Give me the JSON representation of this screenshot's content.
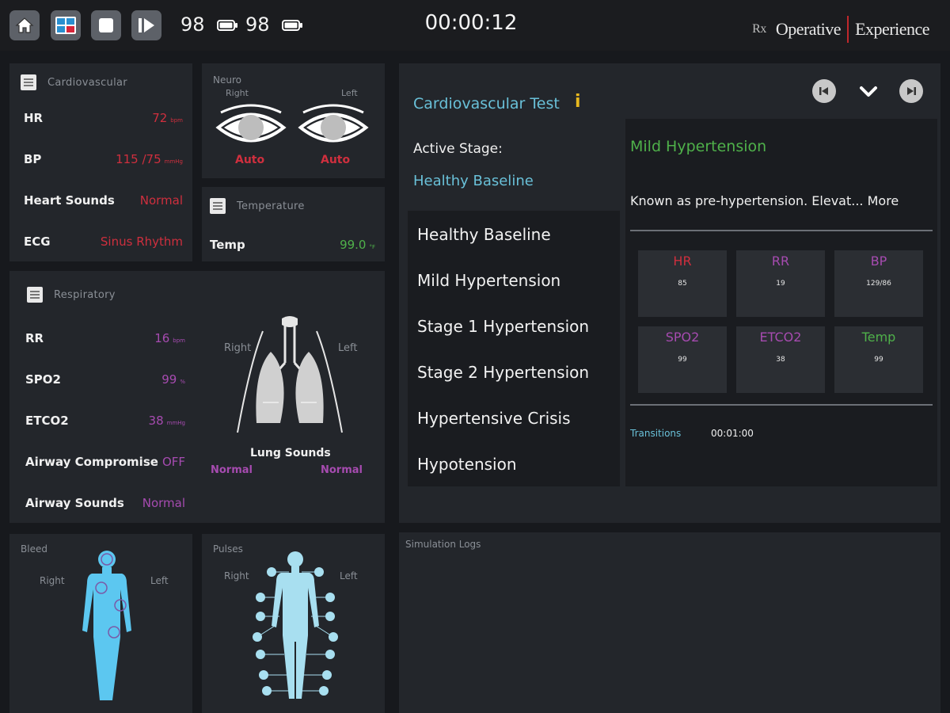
{
  "topbar": {
    "value_a": "98",
    "value_b": "98",
    "timer": "00:00:12",
    "brand_left": "Operative",
    "brand_right": "Experience",
    "brand_rx": "Rx",
    "icons": [
      "home-icon",
      "layout-icon",
      "stop-icon",
      "play-step-icon",
      "battery-icon",
      "battery-icon"
    ]
  },
  "cardio": {
    "title": "Cardiovascular",
    "rows": [
      {
        "label": "HR",
        "value": "72",
        "unit": "bpm"
      },
      {
        "label": "BP",
        "value": "115 /75",
        "unit": "mmHg"
      },
      {
        "label": "Heart Sounds",
        "value": "Normal",
        "unit": ""
      },
      {
        "label": "ECG",
        "value": "Sinus Rhythm",
        "unit": ""
      }
    ]
  },
  "neuro": {
    "title": "Neuro",
    "right": "Right",
    "left": "Left",
    "right_value": "Auto",
    "left_value": "Auto"
  },
  "temperature": {
    "title": "Temperature",
    "label": "Temp",
    "value": "99.0",
    "unit": "°F"
  },
  "respiratory": {
    "title": "Respiratory",
    "rows": [
      {
        "label": "RR",
        "value": "16",
        "unit": "bpm"
      },
      {
        "label": "SPO2",
        "value": "99",
        "unit": "%"
      },
      {
        "label": "ETCO2",
        "value": "38",
        "unit": "mmHg"
      },
      {
        "label": "Airway Compromise",
        "value": "OFF",
        "unit": ""
      },
      {
        "label": "Airway Sounds",
        "value": "Normal",
        "unit": ""
      }
    ],
    "right": "Right",
    "left": "Left",
    "lung_title": "Lung Sounds",
    "lung_right": "Normal",
    "lung_left": "Normal"
  },
  "bleed": {
    "title": "Bleed",
    "right": "Right",
    "left": "Left"
  },
  "pulses": {
    "title": "Pulses",
    "right": "Right",
    "left": "Left"
  },
  "scenario": {
    "title": "Cardiovascular Test",
    "info_icon": "i",
    "active_stage_label": "Active Stage:",
    "active_stage": "Healthy Baseline",
    "stages": [
      "Healthy Baseline",
      "Mild Hypertension",
      "Stage 1 Hypertension",
      "Stage 2 Hypertension",
      "Hypertensive Crisis",
      "Hypotension"
    ],
    "selected_title": "Mild Hypertension",
    "description": "Known as pre-hypertension. Elevat...",
    "more": "More",
    "vitals": [
      {
        "label": "HR",
        "value": "85",
        "color": "#cf2f3e"
      },
      {
        "label": "RR",
        "value": "19",
        "color": "#a64bb0"
      },
      {
        "label": "BP",
        "value": "129/86",
        "color": "#a64bb0"
      },
      {
        "label": "SPO2",
        "value": "99",
        "color": "#a64bb0"
      },
      {
        "label": "ETCO2",
        "value": "38",
        "color": "#a64bb0"
      },
      {
        "label": "Temp",
        "value": "99",
        "color": "#4fb14a"
      }
    ],
    "transitions_label": "Transitions",
    "transitions_time": "00:01:00"
  },
  "logs": {
    "title": "Simulation Logs"
  }
}
